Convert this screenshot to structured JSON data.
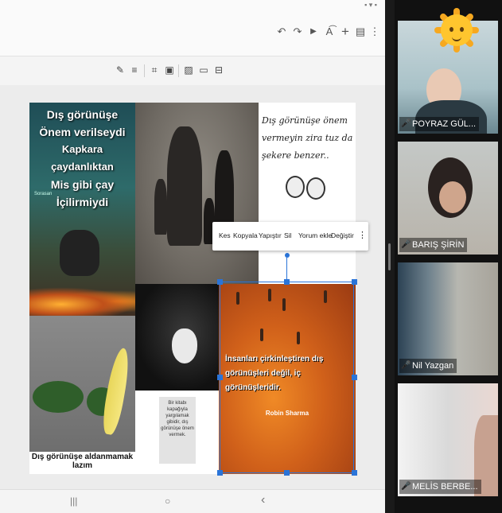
{
  "statusbar": {
    "icons": "▪ ▾ ▪"
  },
  "appbar": {
    "icons": [
      "undo-icon",
      "redo-icon",
      "play-icon",
      "text-format-icon",
      "add-icon",
      "comment-icon",
      "more-vert-icon"
    ],
    "glyphs": {
      "undo": "↶",
      "redo": "↷",
      "play": "▶",
      "format": "A͡",
      "add": "+",
      "comment": "▤",
      "more": "⋮"
    }
  },
  "format_toolbar": {
    "glyphs": {
      "pen": "✎",
      "align": "≡",
      "crop": "⌗",
      "image": "▣",
      "replace": "▨",
      "reset": "▭",
      "mask": "⊟"
    }
  },
  "slide": {
    "tile1": {
      "lines": [
        "Dış görünüşe",
        "Önem verilseydi",
        "Kapkara çaydanlıktan",
        "Mis gibi çay",
        "İçilirmiydi"
      ],
      "small": "Sorasan"
    },
    "tile3": {
      "text": "Dış görünüşe önem vermeyin zira tuz da şekere benzer.."
    },
    "tile4": {
      "caption": "Dış görünüşe aldanmamak lazım"
    },
    "tile6": {
      "note": "Bir kitabı kapağıyla yargılamak gibidir, dış görünüşe önem vermek."
    },
    "tile7": {
      "quote": "İnsanları çirkinleştiren dış görünüşleri değil, iç görünüşleridir.",
      "author": "Robin Sharma"
    }
  },
  "context_menu": {
    "items": [
      "Kes",
      "Kopyala",
      "Yapıştır",
      "Sil",
      "Yorum ekle",
      "Değiştir"
    ],
    "more": "⋮"
  },
  "navbar": {
    "recents": "|||",
    "home": "○",
    "back": "‹"
  },
  "participants": [
    {
      "name": "POYRAZ GÜL..."
    },
    {
      "name": "BARIŞ ŞİRİN"
    },
    {
      "name": "Nil Yazgan"
    },
    {
      "name": "MELİS BERBE..."
    }
  ],
  "mic_off_icon": "🎤",
  "colors": {
    "selection": "#2a74d8",
    "mic_off": "#e53935"
  }
}
